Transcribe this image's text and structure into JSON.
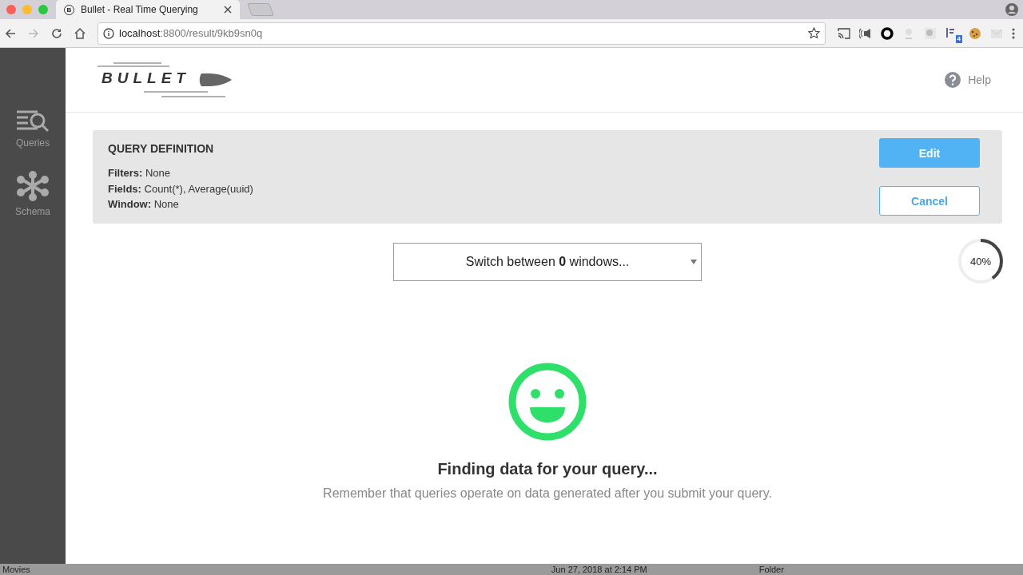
{
  "browser": {
    "tab_title": "Bullet - Real Time Querying",
    "tab_icon": "B",
    "url_host": "localhost",
    "url_path": ":8800/result/9kb9sn0q",
    "extension_badge": "4"
  },
  "sidebar": {
    "items": [
      {
        "label": "Queries",
        "kind": "queries"
      },
      {
        "label": "Schema",
        "kind": "schema"
      }
    ]
  },
  "header": {
    "logo": "BULLET",
    "help": "Help"
  },
  "query_definition": {
    "title": "QUERY DEFINITION",
    "lines": [
      {
        "label": "Filters:",
        "value": "None"
      },
      {
        "label": "Fields:",
        "value": "Count(*), Average(uuid)"
      },
      {
        "label": "Window:",
        "value": "None"
      }
    ],
    "buttons": [
      {
        "label": "Edit",
        "kind": "primary"
      },
      {
        "label": "Cancel",
        "kind": "secondary"
      }
    ]
  },
  "window_switcher": {
    "text": "Switch between **0** windows..."
  },
  "progress": {
    "level": 0.4,
    "reading": "40%"
  },
  "status": {
    "title": "Finding data for your query...",
    "message": "Remember that queries operate on data generated after you submit your query."
  },
  "finder_strip": {
    "name": "Movies",
    "date": "Jun 27, 2018 at 2:14 PM",
    "kind": "Folder"
  }
}
